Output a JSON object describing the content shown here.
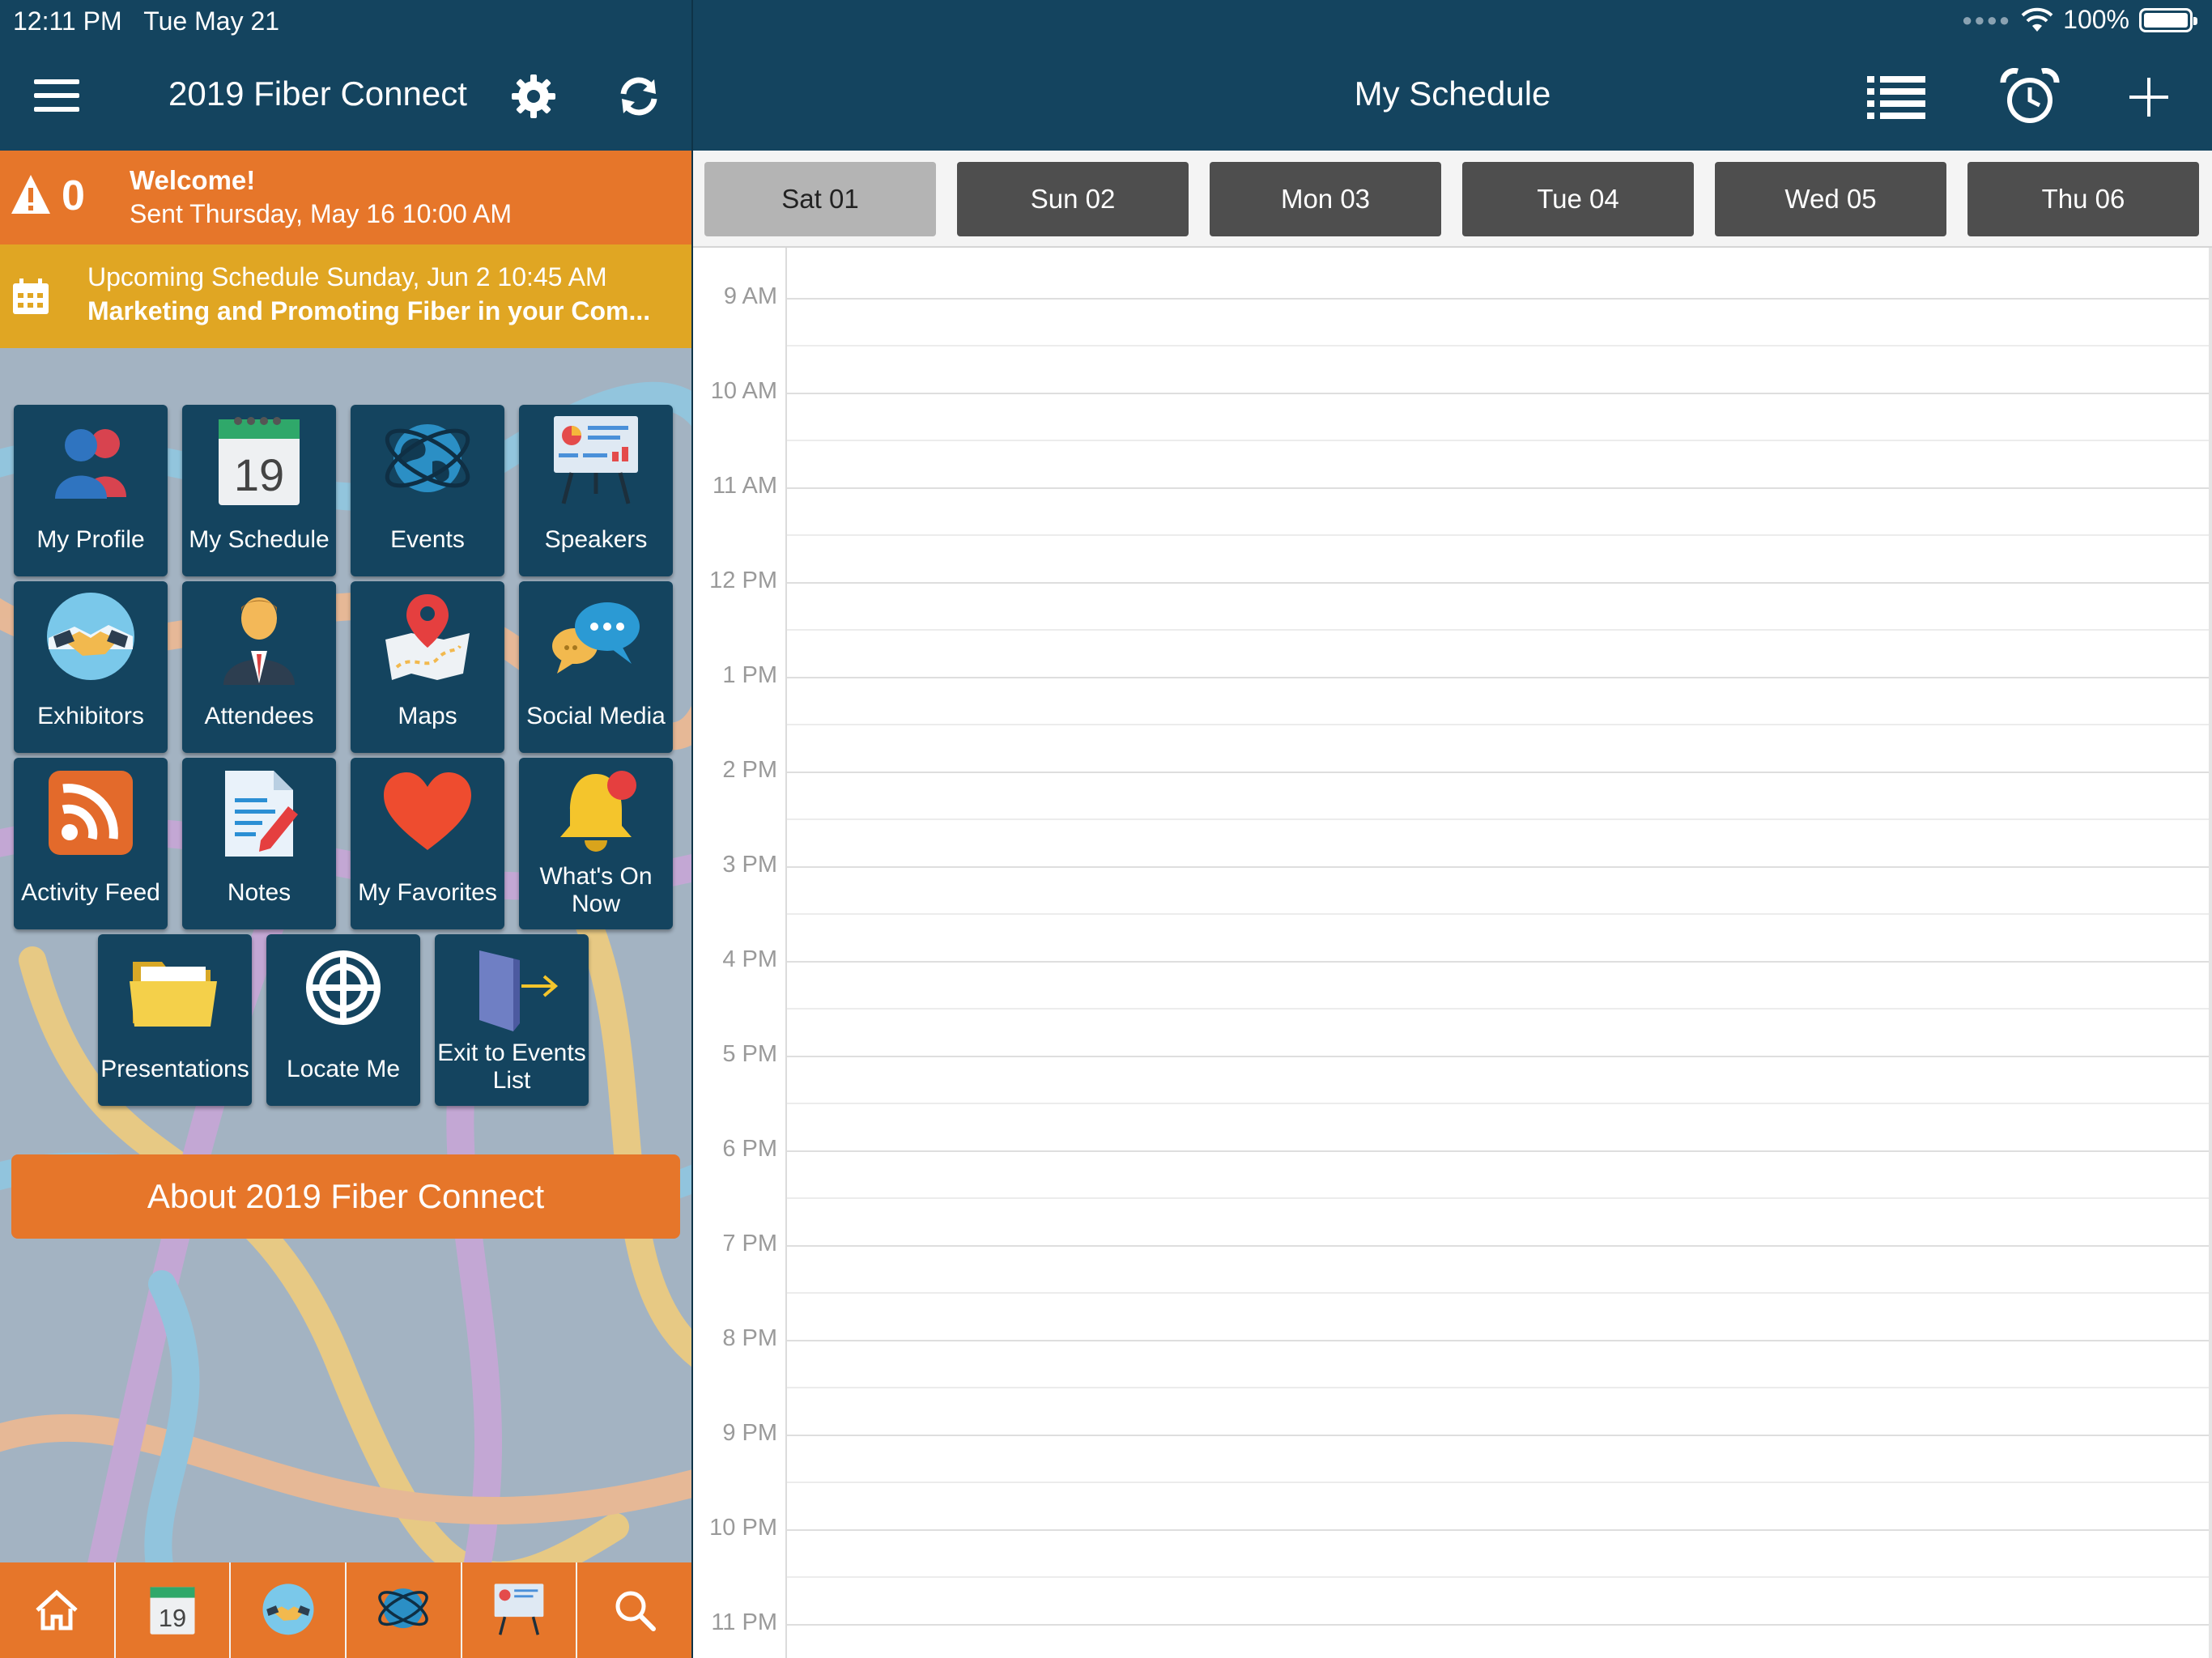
{
  "status": {
    "time": "12:11 PM",
    "date": "Tue May 21",
    "battery": "100%"
  },
  "left_header": {
    "title": "2019 Fiber Connect"
  },
  "right_header": {
    "title": "My Schedule"
  },
  "alert": {
    "count": "0",
    "title": "Welcome!",
    "subtitle": "Sent Thursday, May 16 10:00 AM"
  },
  "upcoming": {
    "line1": "Upcoming Schedule Sunday, Jun 2 10:45 AM",
    "line2": "Marketing and Promoting Fiber in your Com..."
  },
  "tiles": [
    {
      "label": "My Profile",
      "icon": "profile-icon"
    },
    {
      "label": "My Schedule",
      "icon": "calendar-icon",
      "day": "19"
    },
    {
      "label": "Events",
      "icon": "globe-icon"
    },
    {
      "label": "Speakers",
      "icon": "presentation-board-icon"
    },
    {
      "label": "Exhibitors",
      "icon": "handshake-icon"
    },
    {
      "label": "Attendees",
      "icon": "attendee-icon"
    },
    {
      "label": "Maps",
      "icon": "map-pin-icon"
    },
    {
      "label": "Social Media",
      "icon": "chat-bubbles-icon"
    },
    {
      "label": "Activity Feed",
      "icon": "rss-icon"
    },
    {
      "label": "Notes",
      "icon": "notes-icon"
    },
    {
      "label": "My Favorites",
      "icon": "heart-icon"
    },
    {
      "label": "What's On Now",
      "icon": "bell-icon"
    },
    {
      "label": "Presentations",
      "icon": "folder-icon"
    },
    {
      "label": "Locate Me",
      "icon": "target-icon"
    },
    {
      "label": "Exit to Events List",
      "icon": "exit-door-icon"
    }
  ],
  "about_button": "About 2019 Fiber Connect",
  "bottom_nav": [
    {
      "icon": "home-icon"
    },
    {
      "icon": "calendar-icon",
      "day": "19"
    },
    {
      "icon": "handshake-icon"
    },
    {
      "icon": "globe-icon"
    },
    {
      "icon": "presentation-board-icon"
    },
    {
      "icon": "search-icon"
    }
  ],
  "days": [
    "Sat 01",
    "Sun 02",
    "Mon 03",
    "Tue 04",
    "Wed 05",
    "Thu 06"
  ],
  "selected_day": "Sat 01",
  "hours": [
    "9 AM",
    "10 AM",
    "11 AM",
    "12 PM",
    "1 PM",
    "2 PM",
    "3 PM",
    "4 PM",
    "5 PM",
    "6 PM",
    "7 PM",
    "8 PM",
    "9 PM",
    "10 PM",
    "11 PM"
  ],
  "colors": {
    "header": "#14445f",
    "orange": "#e6762a",
    "gold": "#e0a623",
    "tile": "#14445f",
    "day_tab": "#4e4e4e",
    "day_tab_active": "#b4b4b4"
  }
}
